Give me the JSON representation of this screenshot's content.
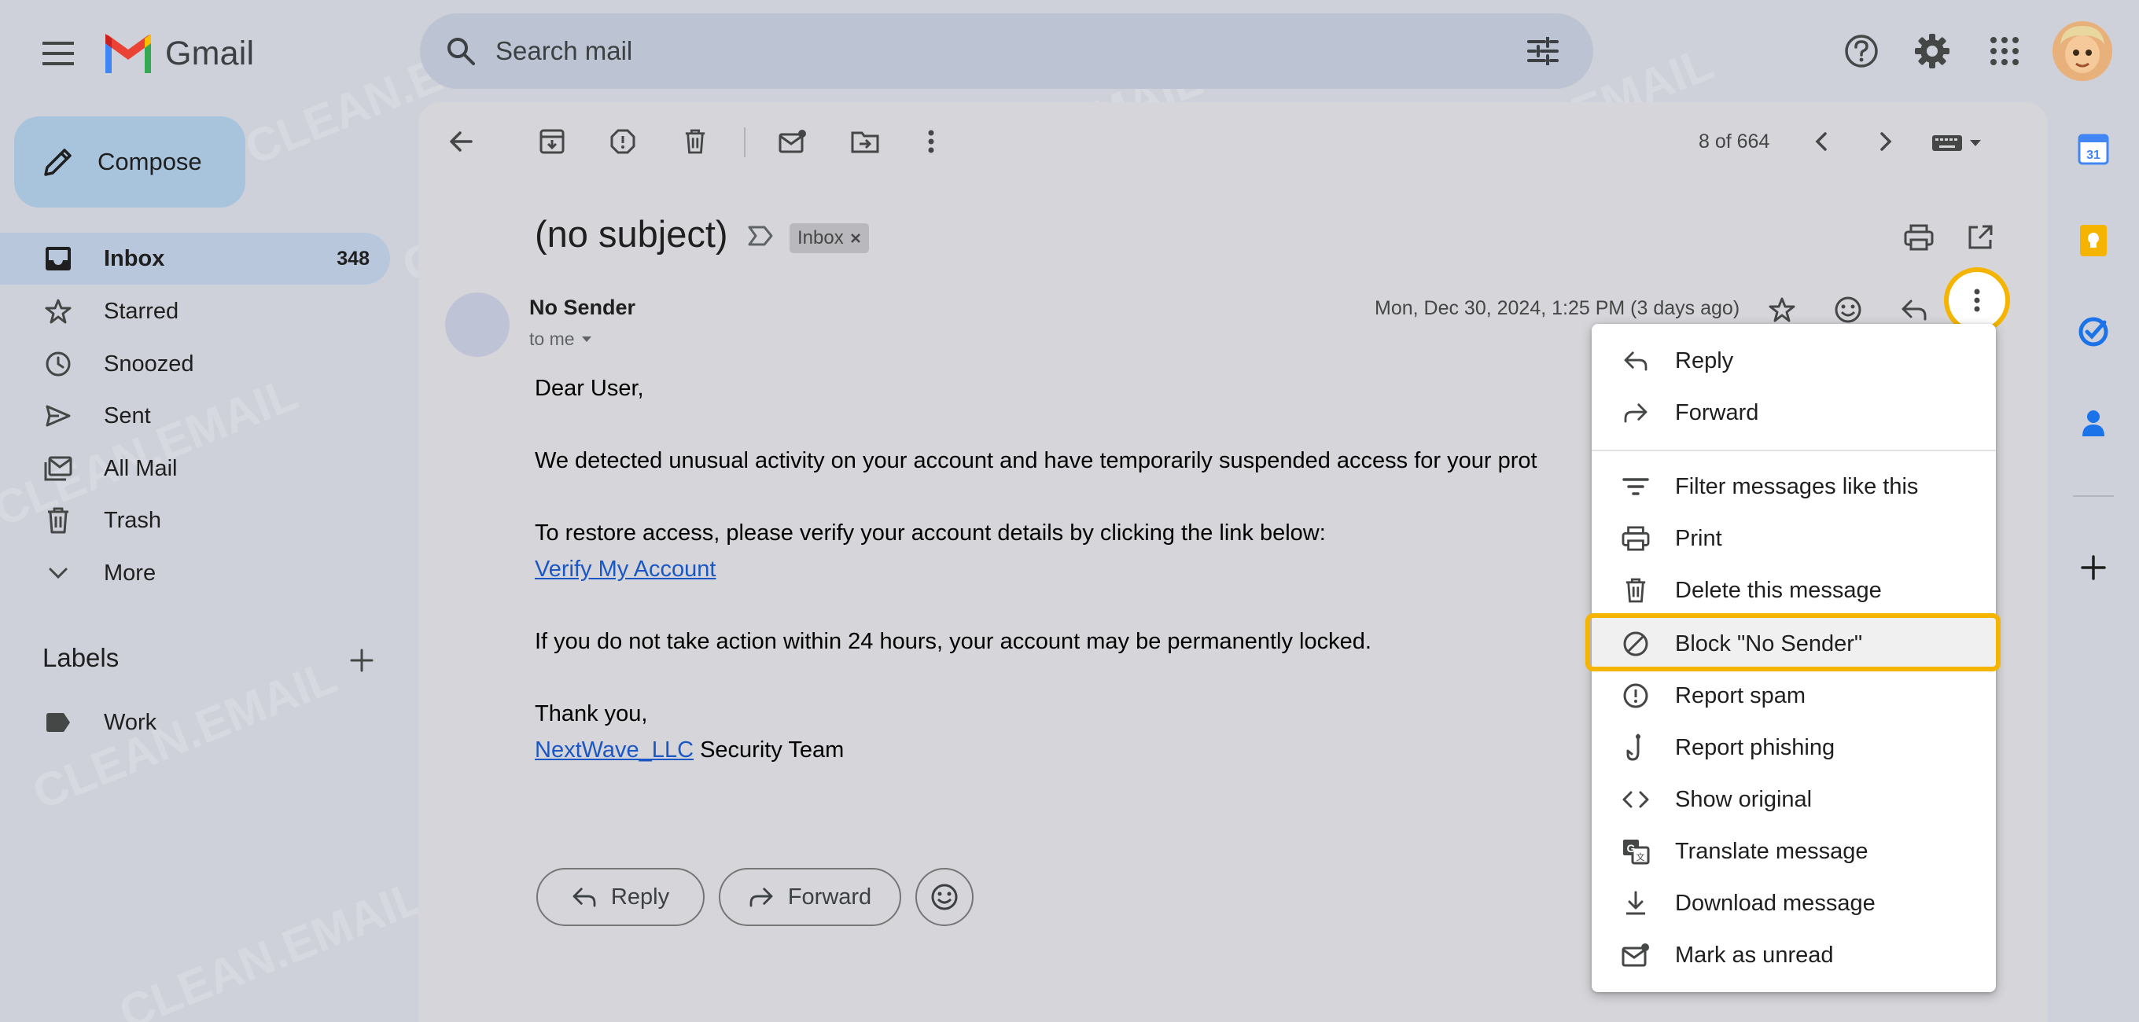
{
  "app": {
    "name": "Gmail"
  },
  "search": {
    "placeholder": "Search mail"
  },
  "compose": {
    "label": "Compose"
  },
  "nav": [
    {
      "label": "Inbox",
      "count": "348",
      "icon": "inbox-icon"
    },
    {
      "label": "Starred",
      "icon": "star-icon"
    },
    {
      "label": "Snoozed",
      "icon": "clock-icon"
    },
    {
      "label": "Sent",
      "icon": "send-icon"
    },
    {
      "label": "All Mail",
      "icon": "all-mail-icon"
    },
    {
      "label": "Trash",
      "icon": "trash-icon"
    },
    {
      "label": "More",
      "icon": "chevron-down-icon"
    }
  ],
  "labels": {
    "title": "Labels",
    "items": [
      {
        "label": "Work"
      }
    ]
  },
  "toolbar": {
    "pager": "8 of 664"
  },
  "message": {
    "subject": "(no subject)",
    "label_chip": "Inbox",
    "sender": "No Sender",
    "to": "to me",
    "date": "Mon, Dec 30, 2024, 1:25 PM (3 days ago)",
    "greeting": "Dear User,",
    "para1": "We detected unusual activity on your account and have temporarily suspended access for your prot",
    "para2": "To restore access, please verify your account details by clicking the link below:",
    "link": "Verify My Account",
    "para3": "If you do not take action within 24 hours, your account may be permanently locked.",
    "thanks": "Thank you,",
    "sig_link": "NextWave_LLC",
    "sig_rest": " Security Team"
  },
  "actions": {
    "reply": "Reply",
    "forward": "Forward"
  },
  "menu": {
    "items": [
      {
        "label": "Reply",
        "icon": "reply-icon"
      },
      {
        "label": "Forward",
        "icon": "forward-icon"
      },
      {
        "label": "Filter messages like this",
        "icon": "filter-icon"
      },
      {
        "label": "Print",
        "icon": "print-icon"
      },
      {
        "label": "Delete this message",
        "icon": "trash-icon"
      },
      {
        "label": "Block \"No Sender\"",
        "icon": "block-icon"
      },
      {
        "label": "Report spam",
        "icon": "spam-icon"
      },
      {
        "label": "Report phishing",
        "icon": "phishing-icon"
      },
      {
        "label": "Show original",
        "icon": "code-icon"
      },
      {
        "label": "Translate message",
        "icon": "translate-icon"
      },
      {
        "label": "Download message",
        "icon": "download-icon"
      },
      {
        "label": "Mark as unread",
        "icon": "mark-unread-icon"
      }
    ]
  },
  "watermark": "CLEAN.EMAIL",
  "colors": {
    "highlight": "#f4b400",
    "link": "#1a56c4",
    "compose_bg": "#a8c3dc"
  }
}
